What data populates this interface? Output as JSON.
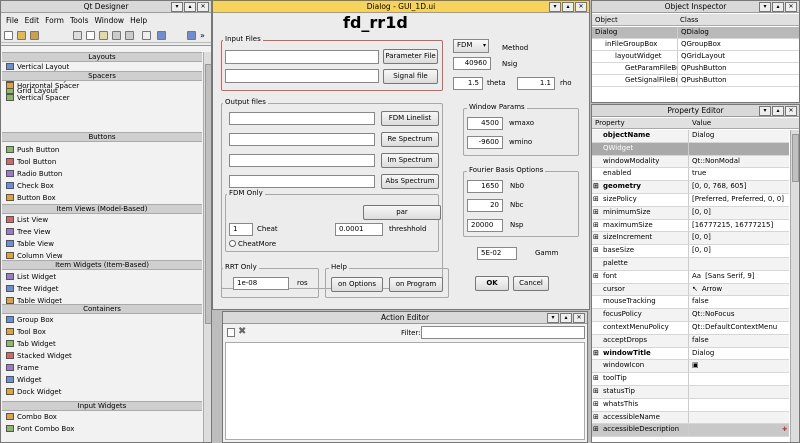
{
  "designer": {
    "title": "Qt Designer",
    "menu": [
      "File",
      "Edit",
      "Form",
      "Tools",
      "Window",
      "Help"
    ]
  },
  "widgetbox": {
    "categories": [
      {
        "name": "Layouts",
        "items": [
          "Vertical Layout",
          "Horizontal Layout",
          "Grid Layout"
        ]
      },
      {
        "name": "Spacers",
        "items": [
          "Horizontal Spacer",
          "Vertical Spacer"
        ]
      },
      {
        "name": "Buttons",
        "items": [
          "Push Button",
          "Tool Button",
          "Radio Button",
          "Check Box",
          "Button Box"
        ]
      },
      {
        "name": "Item Views (Model-Based)",
        "items": [
          "List View",
          "Tree View",
          "Table View",
          "Column View"
        ]
      },
      {
        "name": "Item Widgets (Item-Based)",
        "items": [
          "List Widget",
          "Tree Widget",
          "Table Widget"
        ]
      },
      {
        "name": "Containers",
        "items": [
          "Group Box",
          "Tool Box",
          "Tab Widget",
          "Stacked Widget",
          "Frame",
          "Widget",
          "Dock Widget"
        ]
      },
      {
        "name": "Input Widgets",
        "items": [
          "Combo Box",
          "Font Combo Box"
        ]
      }
    ]
  },
  "dialog": {
    "window_title": "Dialog - GUI_1D.ui",
    "heading": "fd_rr1d",
    "input_files": {
      "title": "Input Files",
      "param_btn": "Parameter File",
      "signal_btn": "Signal file"
    },
    "method": {
      "value": "FDM",
      "label": "Method"
    },
    "nsig": {
      "value": "40960",
      "label": "Nsig"
    },
    "theta": {
      "value": "1.5",
      "label": "theta"
    },
    "rho": {
      "value": "1.1",
      "label": "rho"
    },
    "output_files": {
      "title": "Output files",
      "buttons": [
        "FDM Linelist",
        "Re Spectrum",
        "Im Spectrum",
        "Abs Spectrum"
      ]
    },
    "fdm_only": {
      "title": "FDM Only",
      "par_btn": "par",
      "cheat_value": "1",
      "cheat_label": "Cheat",
      "threshold_value": "0.0001",
      "threshold_label": "threshhold",
      "cheatmore": "CheatMore"
    },
    "window_params": {
      "title": "Window Params",
      "wmax_value": "4500",
      "wmax_label": "wmaxo",
      "wmin_value": "-9600",
      "wmin_label": "wmino"
    },
    "fourier": {
      "title": "Fourier Basis Options",
      "nb0_value": "1650",
      "nb0_label": "Nb0",
      "nbc_value": "20",
      "nbc_label": "Nbc",
      "nsp_value": "20000",
      "nsp_label": "Nsp"
    },
    "gamm": {
      "value": "5E-02",
      "label": "Gamm"
    },
    "rrt": {
      "title": "RRT Only",
      "value": "1e-08",
      "label": "ros"
    },
    "help": {
      "title": "Help",
      "options_btn": "on Options",
      "program_btn": "on Program"
    },
    "ok": "OK",
    "cancel": "Cancel"
  },
  "action_editor": {
    "title": "Action Editor",
    "filter_label": "Filter:"
  },
  "object_inspector": {
    "title": "Object Inspector",
    "headers": [
      "Object",
      "Class"
    ],
    "rows": [
      {
        "object": "Dialog",
        "class": "QDialog",
        "indent": 0,
        "selected": true
      },
      {
        "object": "inFileGroupBox",
        "class": "QGroupBox",
        "indent": 1
      },
      {
        "object": "layoutWidget",
        "class": "QGridLayout",
        "indent": 2
      },
      {
        "object": "GetParamFileButton",
        "class": "QPushButton",
        "indent": 3
      },
      {
        "object": "GetSignalFileButton",
        "class": "QPushButton",
        "indent": 3
      }
    ]
  },
  "property_editor": {
    "title": "Property Editor",
    "headers": [
      "Property",
      "Value"
    ],
    "rows": [
      {
        "p": "objectName",
        "v": "Dialog",
        "bold": true
      },
      {
        "p": "QWidget",
        "v": "",
        "section": true
      },
      {
        "p": "windowModality",
        "v": "Qt::NonModal"
      },
      {
        "p": "enabled",
        "v": "true"
      },
      {
        "p": "geometry",
        "v": "[0, 0, 768, 605]",
        "bold": true,
        "exp": true
      },
      {
        "p": "sizePolicy",
        "v": "[Preferred, Preferred, 0, 0]",
        "exp": true
      },
      {
        "p": "minimumSize",
        "v": "[0, 0]",
        "exp": true
      },
      {
        "p": "maximumSize",
        "v": "[16777215, 16777215]",
        "exp": true
      },
      {
        "p": "sizeIncrement",
        "v": "[0, 0]",
        "exp": true
      },
      {
        "p": "baseSize",
        "v": "[0, 0]",
        "exp": true
      },
      {
        "p": "palette",
        "v": ""
      },
      {
        "p": "font",
        "v": "[Sans Serif, 9]",
        "exp": true,
        "icon": "Aa"
      },
      {
        "p": "cursor",
        "v": "Arrow",
        "icon": "↖"
      },
      {
        "p": "mouseTracking",
        "v": "false"
      },
      {
        "p": "focusPolicy",
        "v": "Qt::NoFocus"
      },
      {
        "p": "contextMenuPolicy",
        "v": "Qt::DefaultContextMenu"
      },
      {
        "p": "acceptDrops",
        "v": "false"
      },
      {
        "p": "windowTitle",
        "v": "Dialog",
        "bold": true,
        "exp": true
      },
      {
        "p": "windowIcon",
        "v": "",
        "icon": "▣"
      },
      {
        "p": "toolTip",
        "v": "",
        "exp": true
      },
      {
        "p": "statusTip",
        "v": "",
        "exp": true
      },
      {
        "p": "whatsThis",
        "v": "",
        "exp": true
      },
      {
        "p": "accessibleName",
        "v": "",
        "exp": true
      },
      {
        "p": "accessibleDescription",
        "v": "",
        "exp": true,
        "highlight": true
      }
    ]
  }
}
